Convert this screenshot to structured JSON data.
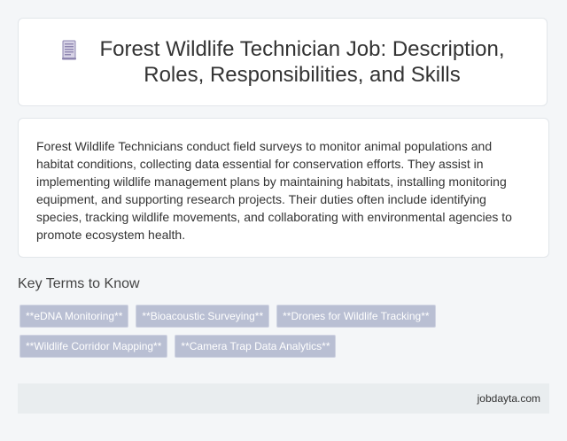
{
  "header": {
    "title": "Forest Wildlife Technician Job: Description, Roles, Responsibilities, and Skills",
    "icon": "document-icon"
  },
  "description": {
    "text": "Forest Wildlife Technicians conduct field surveys to monitor animal populations and habitat conditions, collecting data essential for conservation efforts. They assist in implementing wildlife management plans by maintaining habitats, installing monitoring equipment, and supporting research projects. Their duties often include identifying species, tracking wildlife movements, and collaborating with environmental agencies to promote ecosystem health."
  },
  "key_terms": {
    "heading": "Key Terms to Know",
    "tags": [
      "**eDNA Monitoring**",
      "**Bioacoustic Surveying**",
      "**Drones for Wildlife Tracking**",
      "**Wildlife Corridor Mapping**",
      "**Camera Trap Data Analytics**"
    ]
  },
  "footer": {
    "site": "jobdayta.com"
  },
  "colors": {
    "background": "#f4f6f8",
    "card": "#ffffff",
    "tag_bg": "#b9bfd3",
    "footer_bg": "#e9edef",
    "icon_accent": "#8e86b0"
  }
}
